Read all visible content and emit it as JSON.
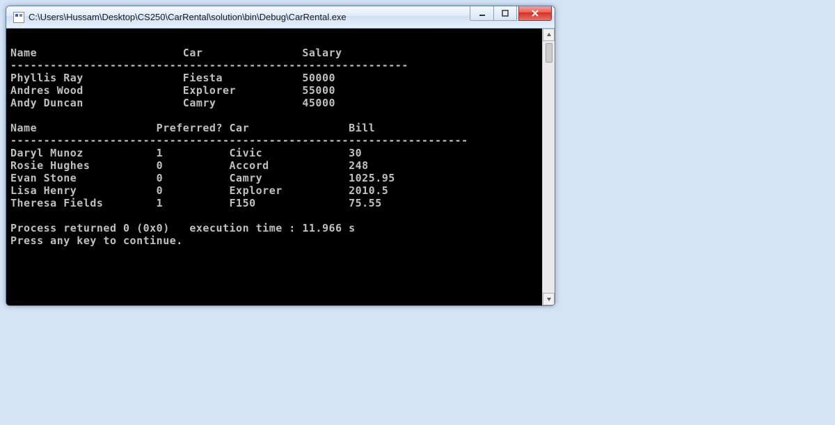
{
  "window": {
    "title": "C:\\Users\\Hussam\\Desktop\\CS250\\CarRental\\solution\\bin\\Debug\\CarRental.exe"
  },
  "table1": {
    "headers": {
      "name": "Name",
      "car": "Car",
      "salary": "Salary"
    },
    "divider": "------------------------------------------------------------",
    "rows": [
      {
        "name": "Phyllis Ray",
        "car": "Fiesta",
        "salary": "50000"
      },
      {
        "name": "Andres Wood",
        "car": "Explorer",
        "salary": "55000"
      },
      {
        "name": "Andy Duncan",
        "car": "Camry",
        "salary": "45000"
      }
    ]
  },
  "table2": {
    "headers": {
      "name": "Name",
      "preferred": "Preferred?",
      "car": "Car",
      "bill": "Bill"
    },
    "divider": "---------------------------------------------------------------------",
    "rows": [
      {
        "name": "Daryl Munoz",
        "preferred": "1",
        "car": "Civic",
        "bill": "30"
      },
      {
        "name": "Rosie Hughes",
        "preferred": "0",
        "car": "Accord",
        "bill": "248"
      },
      {
        "name": "Evan Stone",
        "preferred": "0",
        "car": "Camry",
        "bill": "1025.95"
      },
      {
        "name": "Lisa Henry",
        "preferred": "0",
        "car": "Explorer",
        "bill": "2010.5"
      },
      {
        "name": "Theresa Fields",
        "preferred": "1",
        "car": "F150",
        "bill": "75.55"
      }
    ]
  },
  "footer": {
    "line1": "Process returned 0 (0x0)   execution time : 11.966 s",
    "line2": "Press any key to continue."
  },
  "cols1": {
    "name": 26,
    "car": 18
  },
  "cols2": {
    "name": 22,
    "pref": 11,
    "car": 18
  }
}
